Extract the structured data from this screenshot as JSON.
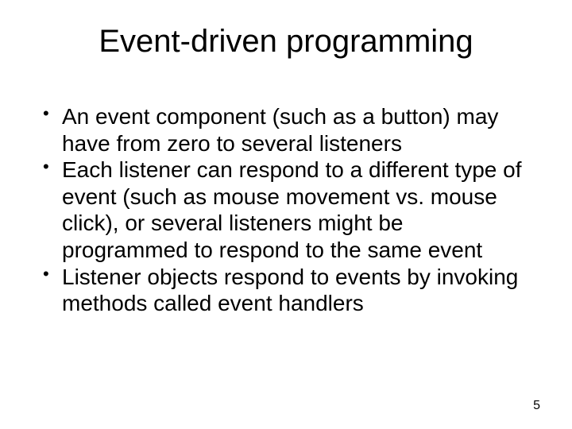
{
  "slide": {
    "title": "Event-driven programming",
    "bullets": [
      "An event component (such as a button) may have from zero to several listeners",
      "Each listener can respond to a different type of event (such as mouse movement vs. mouse click), or several listeners might be programmed to respond to the same event",
      "Listener objects respond to events by invoking methods called event handlers"
    ],
    "page_number": "5"
  }
}
